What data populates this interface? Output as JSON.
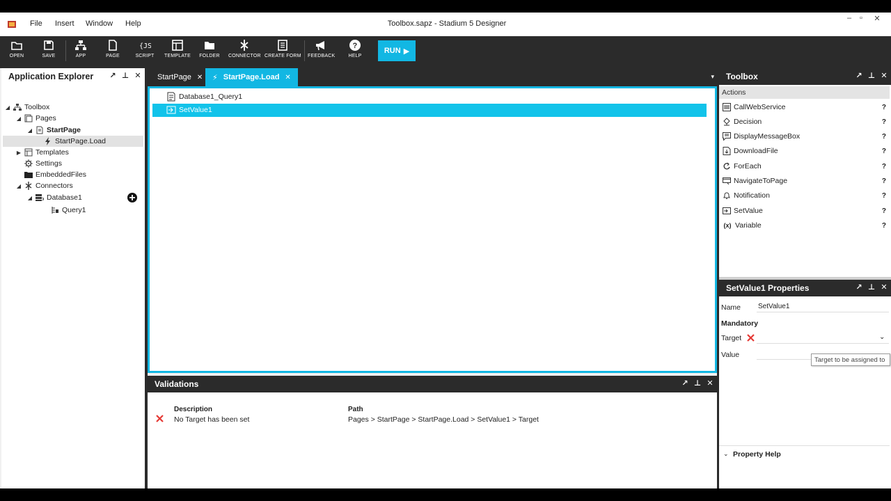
{
  "window": {
    "title": "Toolbox.sapz - Stadium 5 Designer",
    "menu": [
      "File",
      "Insert",
      "Window",
      "Help"
    ]
  },
  "toolbar": {
    "buttons": [
      "OPEN",
      "SAVE",
      "APP",
      "PAGE",
      "SCRIPT",
      "TEMPLATE",
      "FOLDER",
      "CONNECTOR",
      "CREATE FORM",
      "FEEDBACK",
      "HELP"
    ],
    "run_label": "RUN",
    "script_glyph": "{JS}",
    "help_glyph": "?"
  },
  "explorer": {
    "title": "Application Explorer",
    "tree": [
      {
        "label": "Toolbox",
        "icon": "app-tree-icon"
      },
      {
        "label": "Pages",
        "icon": "pages-icon"
      },
      {
        "label": "StartPage",
        "icon": "page-icon"
      },
      {
        "label": "StartPage.Load",
        "icon": "lightning-icon"
      },
      {
        "label": "Templates",
        "icon": "templates-icon"
      },
      {
        "label": "Settings",
        "icon": "gear-icon"
      },
      {
        "label": "EmbeddedFiles",
        "icon": "folder-icon"
      },
      {
        "label": "Connectors",
        "icon": "connector-icon"
      },
      {
        "label": "Database1",
        "icon": "database-icon"
      },
      {
        "label": "Query1",
        "icon": "query-icon"
      }
    ]
  },
  "editor": {
    "tabs": [
      {
        "label": "StartPage",
        "active": false
      },
      {
        "label": "StartPage.Load",
        "active": true
      }
    ],
    "actions": [
      {
        "label": "Database1_Query1",
        "selected": false
      },
      {
        "label": "SetValue1",
        "selected": true
      }
    ]
  },
  "validations": {
    "title": "Validations",
    "col_description": "Description",
    "col_path": "Path",
    "rows": [
      {
        "description": "No Target has been set",
        "path": "Pages > StartPage > StartPage.Load > SetValue1 > Target"
      }
    ]
  },
  "toolbox": {
    "title": "Toolbox",
    "group": "Actions",
    "items": [
      {
        "label": "CallWebService",
        "icon": "web-service-icon"
      },
      {
        "label": "Decision",
        "icon": "decision-icon"
      },
      {
        "label": "DisplayMessageBox",
        "icon": "message-box-icon"
      },
      {
        "label": "DownloadFile",
        "icon": "download-icon"
      },
      {
        "label": "ForEach",
        "icon": "loop-icon"
      },
      {
        "label": "NavigateToPage",
        "icon": "navigate-icon"
      },
      {
        "label": "Notification",
        "icon": "bell-icon"
      },
      {
        "label": "SetValue",
        "icon": "set-value-icon"
      },
      {
        "label": "Variable",
        "icon": "variable-icon"
      }
    ],
    "help_mark": "?",
    "variable_glyph": "(x)"
  },
  "properties": {
    "title": "SetValue1 Properties",
    "name_label": "Name",
    "name_value": "SetValue1",
    "section": "Mandatory",
    "target_label": "Target",
    "target_value": "",
    "value_label": "Value",
    "value_value": "",
    "tooltip": "Target to be assigned to",
    "help_section": "Property Help"
  },
  "colors": {
    "accent": "#12b7e3",
    "dark": "#2b2b2b",
    "error": "#e53935"
  }
}
